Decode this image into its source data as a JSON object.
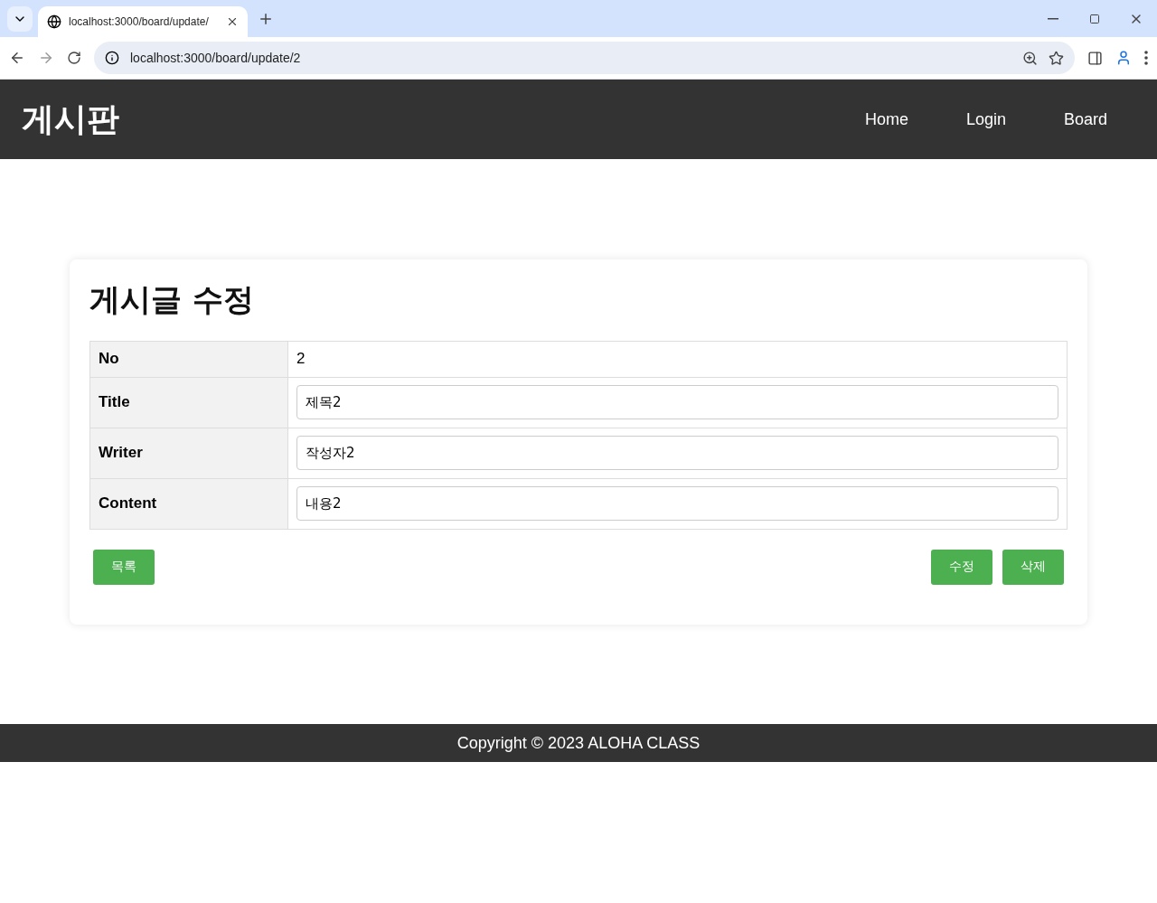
{
  "browser": {
    "tab_title": "localhost:3000/board/update/",
    "url": "localhost:3000/board/update/2"
  },
  "header": {
    "logo": "게시판",
    "nav": [
      "Home",
      "Login",
      "Board"
    ]
  },
  "form": {
    "title": "게시글 수정",
    "rows": [
      {
        "label": "No",
        "kind": "text",
        "value": "2"
      },
      {
        "label": "Title",
        "kind": "input",
        "value": "제목2"
      },
      {
        "label": "Writer",
        "kind": "input",
        "value": "작성자2"
      },
      {
        "label": "Content",
        "kind": "input",
        "value": "내용2"
      }
    ],
    "left_buttons": [
      "목록"
    ],
    "right_buttons": [
      "수정",
      "삭제"
    ]
  },
  "footer": "Copyright © 2023 ALOHA CLASS"
}
